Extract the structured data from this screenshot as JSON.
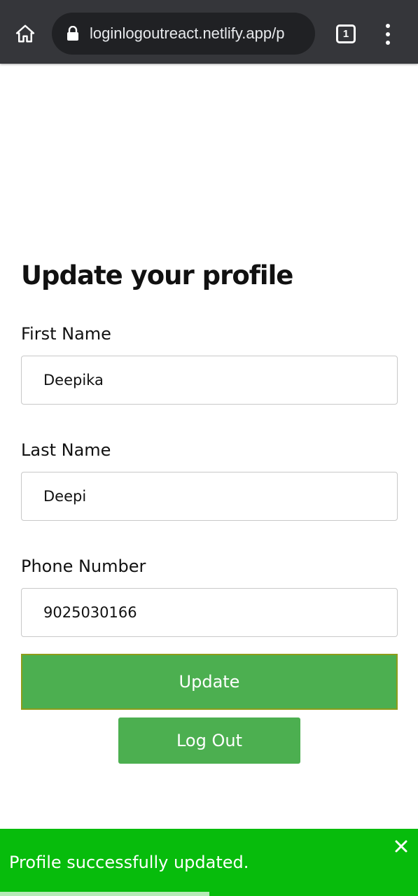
{
  "browser": {
    "url": "loginlogoutreact.netlify.app/p",
    "tab_count": "1",
    "icons": [
      "home-icon",
      "lock-icon",
      "tabs-icon",
      "more-vert-icon"
    ]
  },
  "form": {
    "title": "Update your profile",
    "first_name": {
      "label": "First Name",
      "value": "Deepika"
    },
    "last_name": {
      "label": "Last Name",
      "value": "Deepi"
    },
    "phone": {
      "label": "Phone Number",
      "value": "9025030166"
    },
    "update_label": "Update",
    "logout_label": "Log Out"
  },
  "toast": {
    "message": "Profile successfully updated.",
    "progress_fraction": 0.5,
    "close_icon": "close-icon"
  },
  "colors": {
    "button_green": "#4caf50",
    "toast_green": "#07bc0c",
    "chrome_bg": "#35363a"
  }
}
